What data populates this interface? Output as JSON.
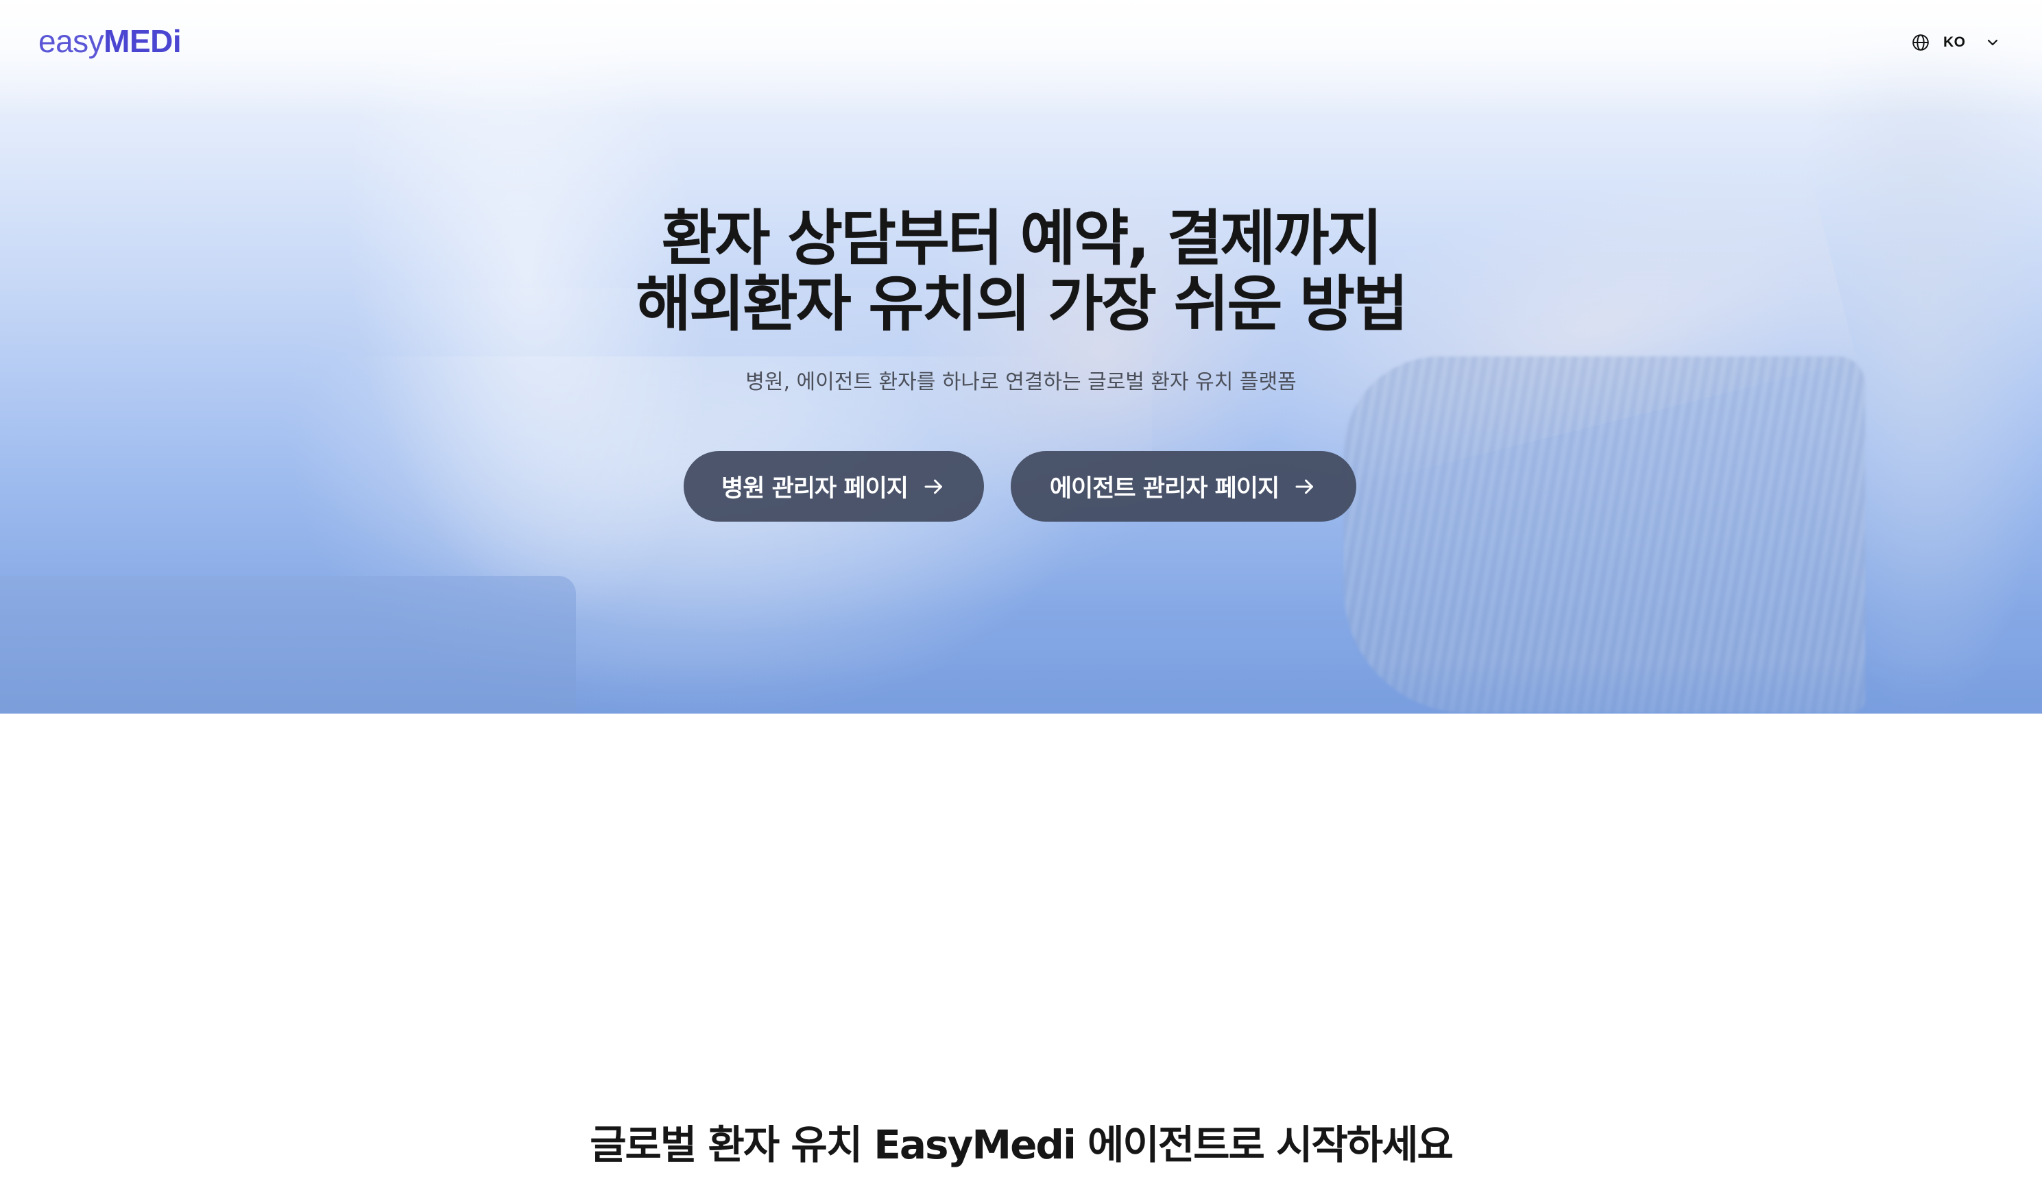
{
  "header": {
    "logo_light": "easy",
    "logo_bold": "MEDi",
    "language": "KO"
  },
  "hero": {
    "title_line1": "환자 상담부터 예약, 결제까지",
    "title_line2": "해외환자 유치의 가장 쉬운 방법",
    "subtitle": "병원, 에이전트 환자를 하나로 연결하는 글로벌 환자 유치 플랫폼",
    "buttons": [
      {
        "label": "병원 관리자 페이지",
        "icon": "arrow-right-icon"
      },
      {
        "label": "에이전트 관리자 페이지",
        "icon": "arrow-right-icon"
      }
    ]
  },
  "section": {
    "title": "글로벌 환자 유치 EasyMedi 에이전트로 시작하세요"
  },
  "colors": {
    "brand": "#4b46d1",
    "button_bg": "#424a60",
    "hero_top": "#f5f8fd",
    "hero_bottom": "#7b9fdf",
    "text_dark": "#161616"
  }
}
